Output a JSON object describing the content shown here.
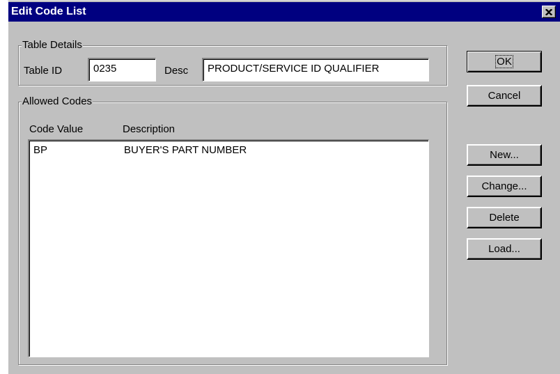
{
  "window": {
    "title": "Edit Code List"
  },
  "table_details": {
    "group_label": "Table Details",
    "table_id_label": "Table ID",
    "table_id_value": "0235",
    "desc_label": "Desc",
    "desc_value": "PRODUCT/SERVICE ID QUALIFIER"
  },
  "allowed_codes": {
    "group_label": "Allowed Codes",
    "columns": [
      "Code Value",
      "Description"
    ],
    "rows": [
      {
        "code": "BP",
        "description": "BUYER'S PART NUMBER"
      }
    ]
  },
  "buttons": {
    "ok": "OK",
    "cancel": "Cancel",
    "new": "New...",
    "change": "Change...",
    "delete": "Delete",
    "load": "Load..."
  }
}
